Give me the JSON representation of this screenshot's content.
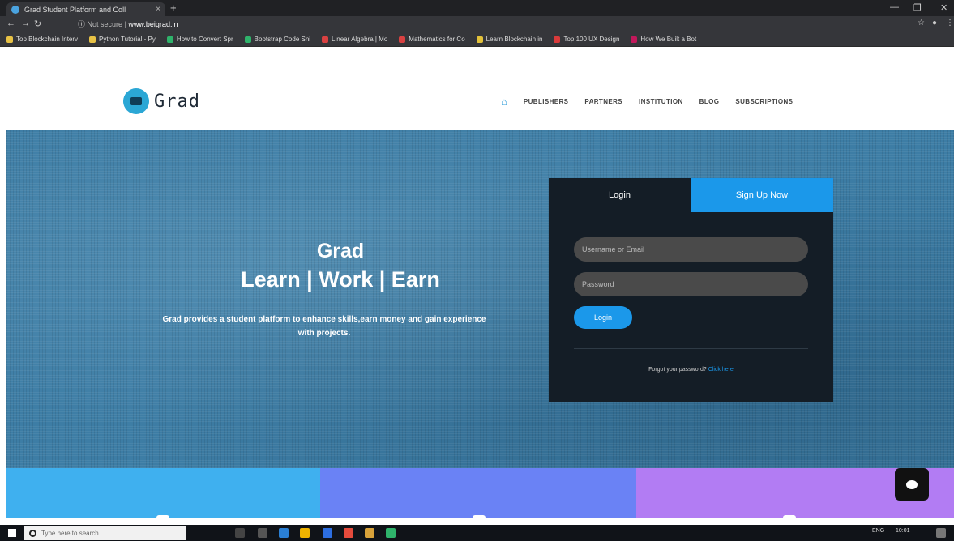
{
  "browser": {
    "tab_title": "Grad Student Platform and Coll",
    "tab_close": "×",
    "new_tab": "+",
    "url_security": "Not secure",
    "url": "www.beigrad.in",
    "bookmarks": [
      {
        "label": "Top Blockchain Interv",
        "color": "#e8c245"
      },
      {
        "label": "Python Tutorial - Py",
        "color": "#e8c245"
      },
      {
        "label": "How to Convert Spr",
        "color": "#2fb36b"
      },
      {
        "label": "Bootstrap Code Sni",
        "color": "#2fb36b"
      },
      {
        "label": "Linear Algebra | Mo",
        "color": "#d94141"
      },
      {
        "label": "Mathematics for Co",
        "color": "#d94141"
      },
      {
        "label": "Learn Blockchain in",
        "color": "#e3c23a"
      },
      {
        "label": "Top 100 UX Design",
        "color": "#d93a3a"
      },
      {
        "label": "How We Built a Bot",
        "color": "#c2185b"
      }
    ]
  },
  "site": {
    "logo_text": "Grad",
    "menu": [
      "PUBLISHERS",
      "PARTNERS",
      "INSTITUTION",
      "BLOG",
      "SUBSCRIPTIONS"
    ]
  },
  "hero": {
    "title": "Grad",
    "subtitle": "Learn | Work | Earn",
    "description": "Grad provides a student platform to enhance skills,earn money and gain experience with projects."
  },
  "auth": {
    "tab_login": "Login",
    "tab_signup": "Sign Up Now",
    "username_placeholder": "Username or Email",
    "password_placeholder": "Password",
    "login_button": "Login",
    "forgot_text": "Forgot your password? ",
    "forgot_link": "Click here"
  },
  "taskbar": {
    "search_placeholder": "Type here to search",
    "lang": "ENG",
    "time": "10:01"
  },
  "colors": {
    "accent": "#1b98ea",
    "tile1": "#3fb0ef",
    "tile2": "#6a82f5",
    "tile3": "#b27cf3"
  }
}
